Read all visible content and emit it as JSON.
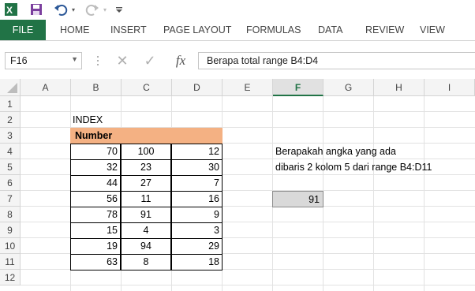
{
  "toolbar": {
    "excel_icon": "excel-logo-icon",
    "save_icon": "save-icon",
    "undo_icon": "undo-icon",
    "redo_icon": "redo-icon",
    "customize_icon": "customize-icon"
  },
  "ribbon": {
    "tabs": [
      "FILE",
      "HOME",
      "INSERT",
      "PAGE LAYOUT",
      "FORMULAS",
      "DATA",
      "REVIEW",
      "VIEW"
    ],
    "accent_color": "#217346"
  },
  "formula_bar": {
    "name_box": "F16",
    "cancel_icon": "✕",
    "enter_icon": "✓",
    "function_icon": "fx",
    "formula": "Berapa total range B4:D4"
  },
  "grid": {
    "columns": [
      "A",
      "B",
      "C",
      "D",
      "E",
      "F",
      "G",
      "H",
      "I"
    ],
    "selected_column": "F",
    "rows": [
      "1",
      "2",
      "3",
      "4",
      "5",
      "6",
      "7",
      "8",
      "9",
      "10",
      "11",
      "12"
    ],
    "title": "INDEX",
    "header": "Number",
    "header_color": "#f4b183",
    "table": [
      [
        "70",
        "100",
        "12"
      ],
      [
        "32",
        "23",
        "30"
      ],
      [
        "44",
        "27",
        "7"
      ],
      [
        "56",
        "11",
        "16"
      ],
      [
        "78",
        "91",
        "9"
      ],
      [
        "15",
        "4",
        "3"
      ],
      [
        "19",
        "94",
        "29"
      ],
      [
        "63",
        "8",
        "18"
      ]
    ],
    "question_line1": "Berapakah angka yang ada",
    "question_line2": "dibaris 2 kolom 5 dari range B4:D11",
    "result": "91"
  }
}
